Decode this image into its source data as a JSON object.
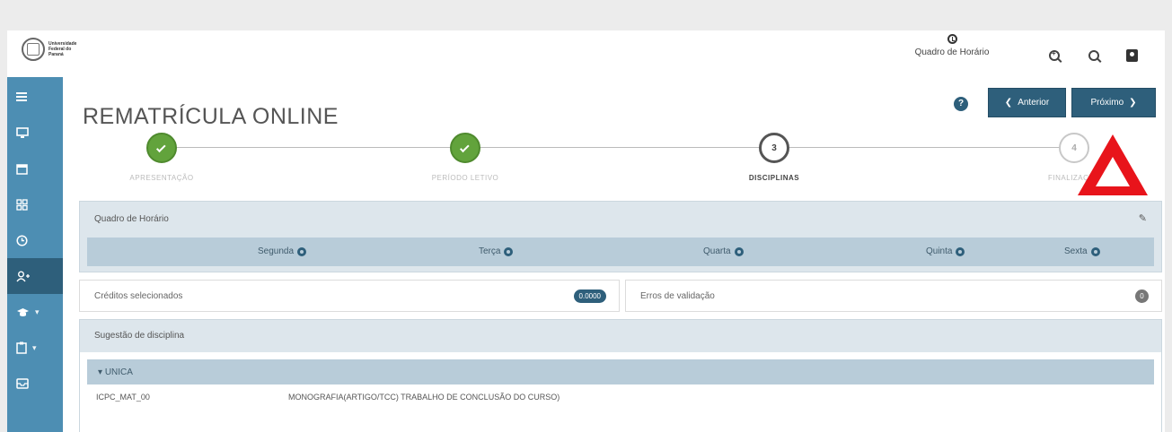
{
  "header": {
    "logo_lines": [
      "Universidade",
      "Federal do",
      "Paraná"
    ],
    "schedule_link": "Quadro de Horário"
  },
  "sidebar": {
    "items": [
      {
        "icon": "menu-icon"
      },
      {
        "icon": "monitor-icon"
      },
      {
        "icon": "calendar-icon"
      },
      {
        "icon": "grid-icon"
      },
      {
        "icon": "clock-icon"
      },
      {
        "icon": "user-add-icon",
        "active": true
      },
      {
        "icon": "graduation-cap-icon",
        "has_submenu": true
      },
      {
        "icon": "clipboard-icon",
        "has_submenu": true
      },
      {
        "icon": "inbox-icon"
      }
    ]
  },
  "page": {
    "title": "REMATRÍCULA ONLINE",
    "prev_label": "Anterior",
    "next_label": "Próximo"
  },
  "stepper": {
    "steps": [
      {
        "label": "APRESENTAÇÃO",
        "state": "done"
      },
      {
        "label": "PERÍODO LETIVO",
        "state": "done"
      },
      {
        "number": "3",
        "label": "DISCIPLINAS",
        "state": "current"
      },
      {
        "number": "4",
        "label": "FINALIZAÇÃO",
        "state": "pending"
      }
    ]
  },
  "schedule": {
    "title": "Quadro de Horário",
    "days": [
      "Segunda",
      "Terça",
      "Quarta",
      "Quinta",
      "Sexta"
    ]
  },
  "credits": {
    "label": "Créditos selecionados",
    "value": "0.0000"
  },
  "errors": {
    "label": "Erros de validação",
    "value": "0"
  },
  "suggestion": {
    "title": "Sugestão de disciplina",
    "group": "UNICA",
    "courses": [
      {
        "code": "ICPC_MAT_00",
        "name": "MONOGRAFIA(ARTIGO/TCC) TRABALHO DE CONCLUSÃO DO CURSO)"
      }
    ]
  },
  "colors": {
    "sidebar": "#4d8eb3",
    "primary": "#2e5f7b",
    "done": "#62a33c",
    "warning": "#e8141b"
  }
}
